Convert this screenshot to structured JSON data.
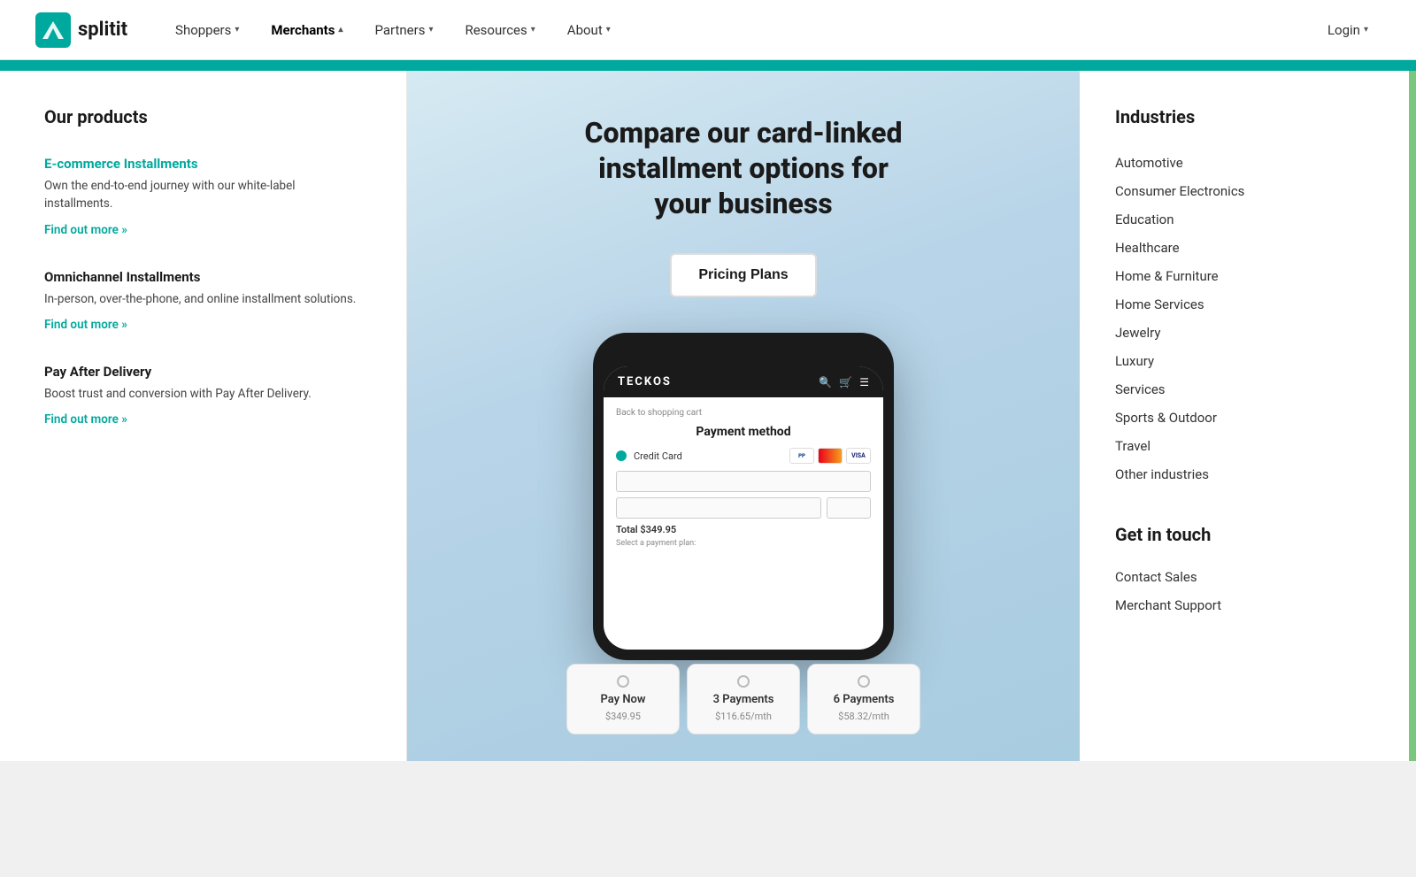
{
  "navbar": {
    "logo_text": "splitit",
    "nav_items": [
      {
        "label": "Shoppers",
        "has_arrow": true,
        "active": false
      },
      {
        "label": "Merchants",
        "has_arrow": true,
        "active": true
      },
      {
        "label": "Partners",
        "has_arrow": true,
        "active": false
      },
      {
        "label": "Resources",
        "has_arrow": true,
        "active": false
      },
      {
        "label": "About",
        "has_arrow": true,
        "active": false
      }
    ],
    "login_label": "Login"
  },
  "left_panel": {
    "title": "Our products",
    "products": [
      {
        "name": "E-commerce Installments",
        "highlight": true,
        "desc": "Own the end-to-end journey with our white-label installments.",
        "link": "Find out more »"
      },
      {
        "name": "Omnichannel Installments",
        "highlight": false,
        "desc": "In-person, over-the-phone, and online installment solutions.",
        "link": "Find out more »"
      },
      {
        "name": "Pay After Delivery",
        "highlight": false,
        "desc": "Boost trust and conversion with Pay After Delivery.",
        "link": "Find out more »"
      }
    ]
  },
  "center_panel": {
    "headline": "Compare our card-linked installment options for your business",
    "pricing_btn": "Pricing Plans",
    "phone": {
      "store_name": "TECKOS",
      "back_link": "Back to shopping cart",
      "payment_title": "Payment method",
      "credit_card_label": "Credit Card",
      "total_label": "Total $349.95",
      "select_plan_label": "Select a payment plan:"
    },
    "payment_options": [
      {
        "label": "Pay Now",
        "sub": "$349.95"
      },
      {
        "label": "3 Payments",
        "sub": "$116.65/mth"
      },
      {
        "label": "6 Payments",
        "sub": "$58.32/mth"
      }
    ]
  },
  "right_panel": {
    "industries_title": "Industries",
    "industries": [
      "Automotive",
      "Consumer Electronics",
      "Education",
      "Healthcare",
      "Home & Furniture",
      "Home Services",
      "Jewelry",
      "Luxury",
      "Services",
      "Sports & Outdoor",
      "Travel",
      "Other industries"
    ],
    "get_in_touch_title": "Get in touch",
    "contacts": [
      "Contact Sales",
      "Merchant Support"
    ]
  }
}
